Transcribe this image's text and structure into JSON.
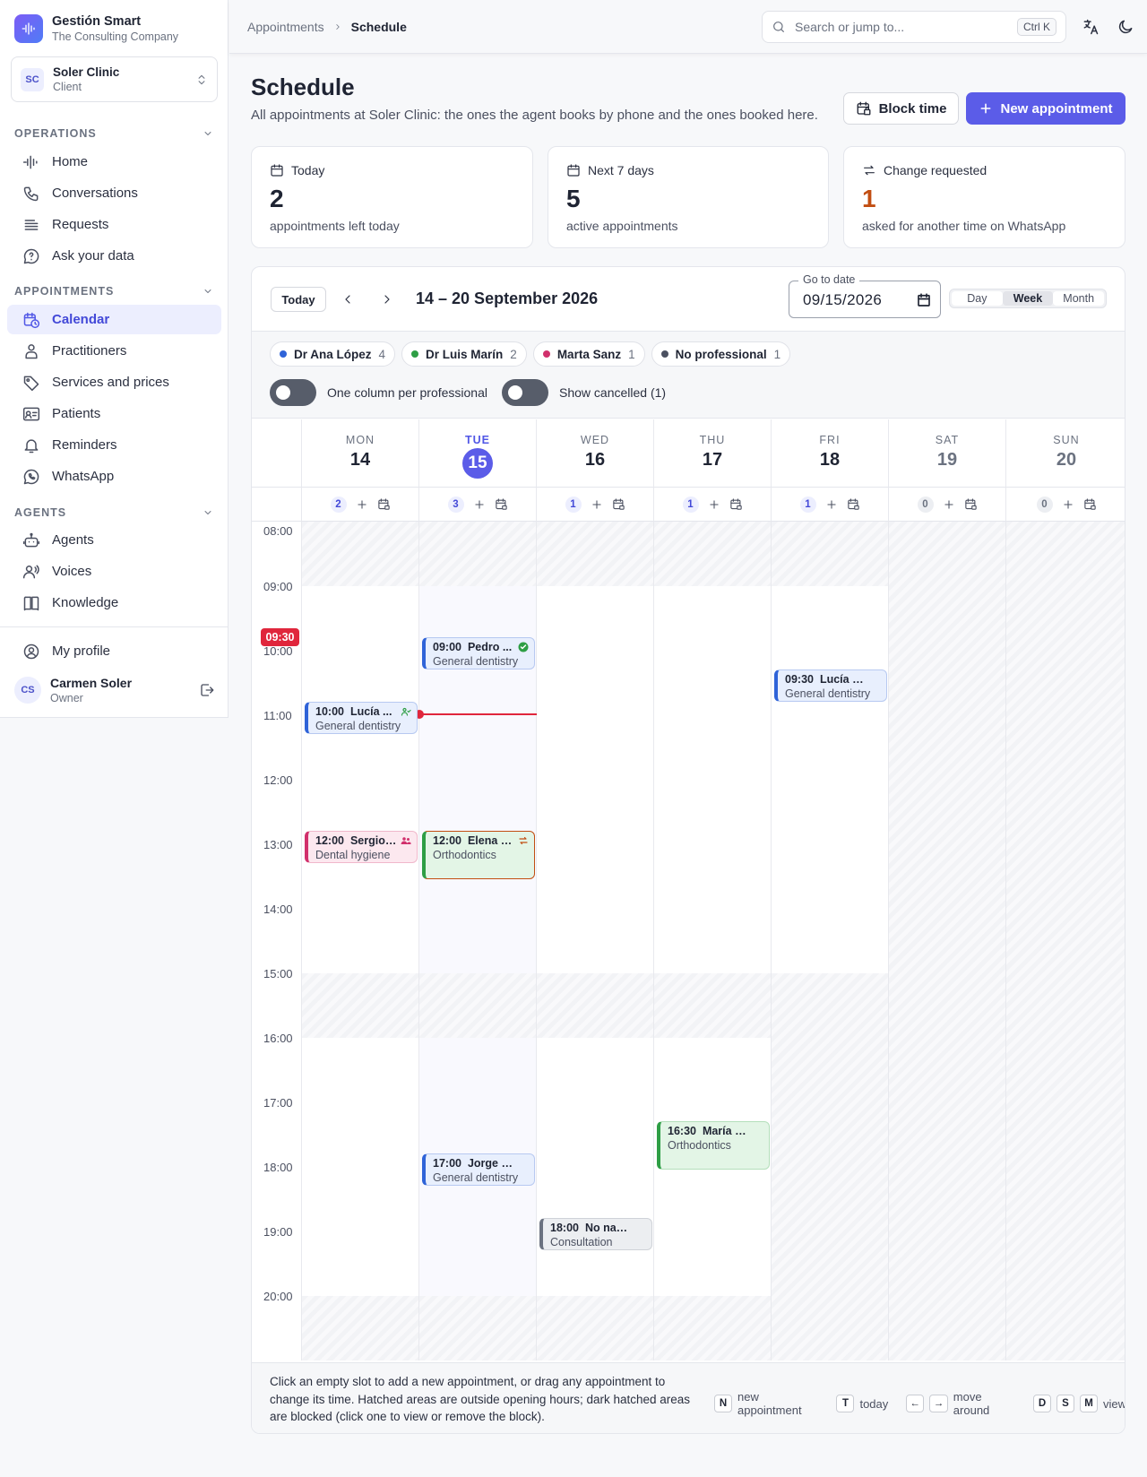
{
  "brand": {
    "name": "Gestión Smart",
    "sub": "The Consulting Company"
  },
  "client": {
    "initials": "SC",
    "name": "Soler Clinic",
    "role": "Client"
  },
  "sidebar": {
    "sections": {
      "operations": "OPERATIONS",
      "appointments": "APPOINTMENTS",
      "agents": "AGENTS"
    },
    "items": {
      "home": "Home",
      "conversations": "Conversations",
      "requests": "Requests",
      "ask": "Ask your data",
      "calendar": "Calendar",
      "practitioners": "Practitioners",
      "services": "Services and prices",
      "patients": "Patients",
      "reminders": "Reminders",
      "whatsapp": "WhatsApp",
      "agents": "Agents",
      "voices": "Voices",
      "knowledge": "Knowledge",
      "profile": "My profile"
    },
    "user": {
      "initials": "CS",
      "name": "Carmen Soler",
      "role": "Owner"
    }
  },
  "topbar": {
    "crumb_parent": "Appointments",
    "crumb_current": "Schedule",
    "search_placeholder": "Search or jump to...",
    "search_shortcut": "Ctrl K"
  },
  "header": {
    "title": "Schedule",
    "subtitle": "All appointments at Soler Clinic: the ones the agent books by phone and the ones booked here.",
    "block_label": "Block time",
    "new_label": "New appointment"
  },
  "stats": [
    {
      "label": "Today",
      "value": "2",
      "sub": "appointments left today"
    },
    {
      "label": "Next 7 days",
      "value": "5",
      "sub": "active appointments"
    },
    {
      "label": "Change requested",
      "value": "1",
      "sub": "asked for another time on WhatsApp"
    }
  ],
  "calendar": {
    "today_label": "Today",
    "range": "14 – 20 September 2026",
    "goto_label": "Go to date",
    "goto_value": "09/15/2026",
    "views": [
      "Day",
      "Week",
      "Month"
    ],
    "selected_view": "Week",
    "professionals": [
      {
        "name": "Dr Ana López",
        "count": "4",
        "color": "#2f63d8"
      },
      {
        "name": "Dr Luis Marín",
        "count": "2",
        "color": "#2e9e45"
      },
      {
        "name": "Marta Sanz",
        "count": "1",
        "color": "#d1306c"
      },
      {
        "name": "No professional",
        "count": "1",
        "color": "#4b5060"
      }
    ],
    "toggles": {
      "per_professional": "One column per professional",
      "show_cancelled": "Show cancelled (1)"
    },
    "days": [
      {
        "dow": "MON",
        "num": "14",
        "count": "2"
      },
      {
        "dow": "TUE",
        "num": "15",
        "count": "3"
      },
      {
        "dow": "WED",
        "num": "16",
        "count": "1"
      },
      {
        "dow": "THU",
        "num": "17",
        "count": "1"
      },
      {
        "dow": "FRI",
        "num": "18",
        "count": "1"
      },
      {
        "dow": "SAT",
        "num": "19",
        "count": "0"
      },
      {
        "dow": "SUN",
        "num": "20",
        "count": "0"
      }
    ],
    "hours": [
      "08:00",
      "09:00",
      "10:00",
      "11:00",
      "12:00",
      "13:00",
      "14:00",
      "15:00",
      "16:00",
      "17:00",
      "18:00",
      "19:00",
      "20:00"
    ],
    "now_label": "09:30",
    "events": {
      "mon1": {
        "time": "10:00",
        "name": "Lucía ...",
        "service": "General dentistry"
      },
      "mon2": {
        "time": "12:00",
        "name": "Sergio ...",
        "service": "Dental hygiene"
      },
      "tue1": {
        "time": "09:00",
        "name": "Pedro ...",
        "service": "General dentistry"
      },
      "tue2": {
        "time": "12:00",
        "name": "Elena R...",
        "service": "Orthodontics"
      },
      "tue3": {
        "time": "17:00",
        "name": "Jorge Pa...",
        "service": "General dentistry"
      },
      "wed1": {
        "time": "18:00",
        "name": "No name",
        "service": "Consultation"
      },
      "thu1": {
        "time": "16:30",
        "name": "María Gil",
        "service": "Orthodontics"
      },
      "fri1": {
        "time": "09:30",
        "name": "Lucía Ma...",
        "service": "General dentistry"
      }
    },
    "footer_text": "Click an empty slot to add a new appointment, or drag any appointment to change its time. Hatched areas are outside opening hours; dark hatched areas are blocked (click one to view or remove the block).",
    "shortcuts": {
      "n_key": "N",
      "n_label": "new appointment",
      "t_key": "T",
      "t_label": "today",
      "left_key": "←",
      "right_key": "→",
      "move_label": "move around",
      "d_key": "D",
      "s_key": "S",
      "m_key": "M",
      "view_label": "view"
    }
  }
}
